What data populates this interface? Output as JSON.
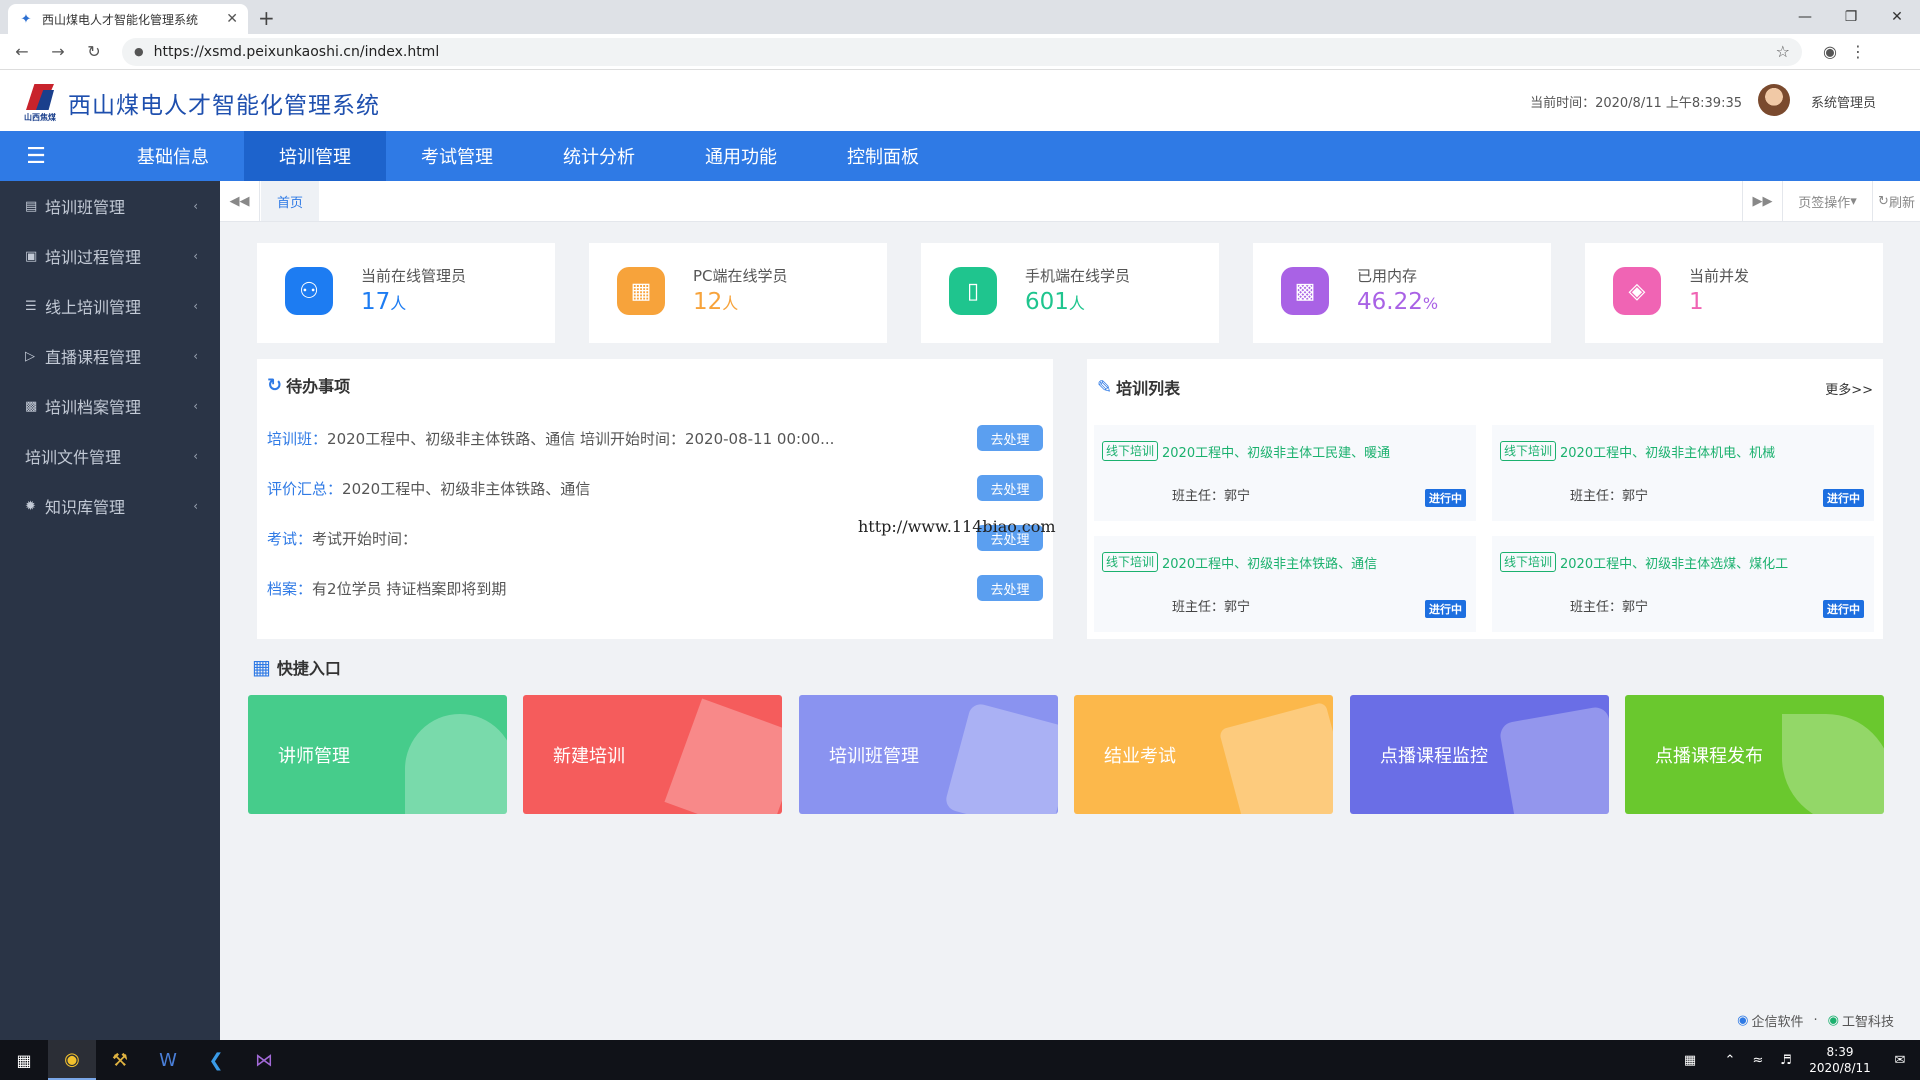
{
  "browser": {
    "tab_title": "西山煤电人才智能化管理系统",
    "url": "https://xsmd.peixunkaoshi.cn/index.html"
  },
  "header": {
    "logo_text": "山西焦煤",
    "title": "西山煤电人才智能化管理系统",
    "current_time": "当前时间：2020/8/11 上午8:39:35",
    "user": "系统管理员"
  },
  "nav": {
    "items": [
      "基础信息",
      "培训管理",
      "考试管理",
      "统计分析",
      "通用功能",
      "控制面板"
    ],
    "active": "培训管理"
  },
  "sidebar": {
    "items": [
      "培训班管理",
      "培训过程管理",
      "线上培训管理",
      "直播课程管理",
      "培训档案管理",
      "培训文件管理",
      "知识库管理"
    ]
  },
  "tabstrip": {
    "home": "首页",
    "page_ops": "页签操作",
    "refresh": "刷新"
  },
  "stats": [
    {
      "label": "当前在线管理员",
      "value": "17",
      "unit": "人",
      "color": "#1d7cf2"
    },
    {
      "label": "PC端在线学员",
      "value": "12",
      "unit": "人",
      "color": "#f7a33b"
    },
    {
      "label": "手机端在线学员",
      "value": "601",
      "unit": "人",
      "color": "#1fc58e"
    },
    {
      "label": "已用内存",
      "value": "46.22",
      "unit": "%",
      "color": "#a962e5"
    },
    {
      "label": "当前并发",
      "value": "1",
      "unit": "",
      "color": "#f064b4"
    }
  ],
  "todo": {
    "title": "待办事项",
    "button": "去处理",
    "rows": [
      {
        "key": "培训班",
        "sep": "：",
        "text": "2020工程中、初级非主体铁路、通信 培训开始时间：2020-08-11 00:00..."
      },
      {
        "key": "评价汇总",
        "sep": "：",
        "text": "2020工程中、初级非主体铁路、通信"
      },
      {
        "key": "考试",
        "sep": "：",
        "text": "考试开始时间："
      },
      {
        "key": "档案",
        "sep": "：",
        "text": "有2位学员 持证档案即将到期"
      }
    ]
  },
  "trainings": {
    "title": "培训列表",
    "more": "更多>>",
    "items": [
      {
        "tag": "线下培训",
        "name": "2020工程中、初级非主体工民建、暖通",
        "head": "班主任：郭宁",
        "status": "进行中"
      },
      {
        "tag": "线下培训",
        "name": "2020工程中、初级非主体机电、机械",
        "head": "班主任：郭宁",
        "status": "进行中"
      },
      {
        "tag": "线下培训",
        "name": "2020工程中、初级非主体铁路、通信",
        "head": "班主任：郭宁",
        "status": "进行中"
      },
      {
        "tag": "线下培训",
        "name": "2020工程中、初级非主体选煤、煤化工",
        "head": "班主任：郭宁",
        "status": "进行中"
      }
    ]
  },
  "quick": {
    "title": "快捷入口",
    "tiles": [
      {
        "label": "讲师管理",
        "color": "#46cc8b"
      },
      {
        "label": "新建培训",
        "color": "#f55c5c"
      },
      {
        "label": "培训班管理",
        "color": "#8a93f0"
      },
      {
        "label": "结业考试",
        "color": "#fcb84b"
      },
      {
        "label": "点播课程监控",
        "color": "#6a6ee6"
      },
      {
        "label": "点播课程发布",
        "color": "#6ac82e"
      }
    ]
  },
  "footer": {
    "company1": "企信软件",
    "company2": "工智科技"
  },
  "watermark": "http://www.114biao.com",
  "taskbar": {
    "time": "8:39",
    "date": "2020/8/11"
  }
}
